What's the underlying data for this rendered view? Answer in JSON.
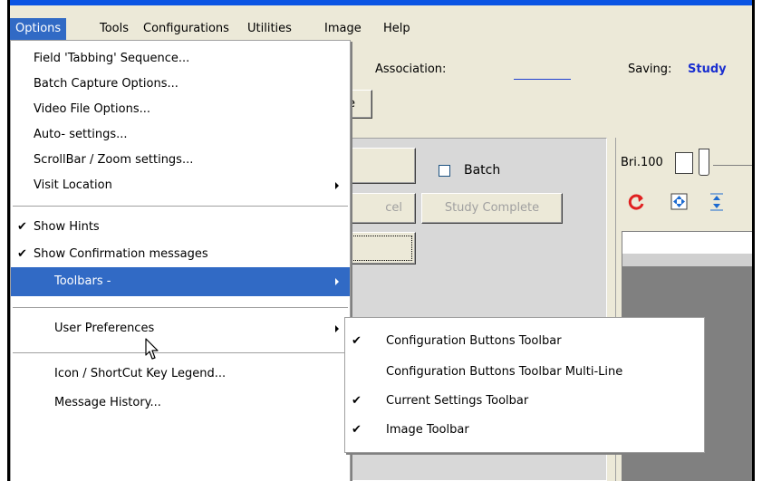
{
  "menubar": {
    "items": [
      "Options",
      "Tools",
      "Configurations",
      "Utilities",
      "Image",
      "Help"
    ]
  },
  "toolbar": {
    "association_label": "Association:",
    "saving_label": "Saving:",
    "saving_value": "Study",
    "partial_button": "e"
  },
  "content": {
    "batch_label": "Batch",
    "cancel_partial": "cel",
    "study_complete": "Study Complete",
    "brightness_label": "Bri.100"
  },
  "options_menu": {
    "items": [
      {
        "label": "Field 'Tabbing' Sequence...",
        "check": false,
        "submenu": false
      },
      {
        "label": "Batch Capture Options...",
        "check": false,
        "submenu": false
      },
      {
        "label": "Video File Options...",
        "check": false,
        "submenu": false
      },
      {
        "label": "Auto- settings...",
        "check": false,
        "submenu": false
      },
      {
        "label": "ScrollBar / Zoom settings...",
        "check": false,
        "submenu": false
      },
      {
        "label": "Visit Location",
        "check": false,
        "submenu": true
      },
      {
        "label": "Show Hints",
        "check": true,
        "submenu": false
      },
      {
        "label": "Show Confirmation messages",
        "check": true,
        "submenu": false
      },
      {
        "label": "Toolbars -",
        "check": false,
        "submenu": true
      },
      {
        "label": "User Preferences",
        "check": false,
        "submenu": true
      },
      {
        "label": "Icon / ShortCut Key Legend...",
        "check": false,
        "submenu": false
      },
      {
        "label": "Message History...",
        "check": false,
        "submenu": false
      }
    ]
  },
  "toolbars_submenu": {
    "items": [
      {
        "label": "Configuration Buttons Toolbar",
        "check": true
      },
      {
        "label": "Configuration Buttons Toolbar Multi-Line",
        "check": false
      },
      {
        "label": "Current Settings Toolbar",
        "check": true
      },
      {
        "label": "Image Toolbar",
        "check": true
      }
    ]
  },
  "check_glyph": "✔",
  "colors": {
    "highlight": "#316ac5",
    "face": "#ece9d8",
    "title_blue": "#0a54e3",
    "link_blue": "#1a2fd0",
    "refresh_red": "#e02020"
  }
}
